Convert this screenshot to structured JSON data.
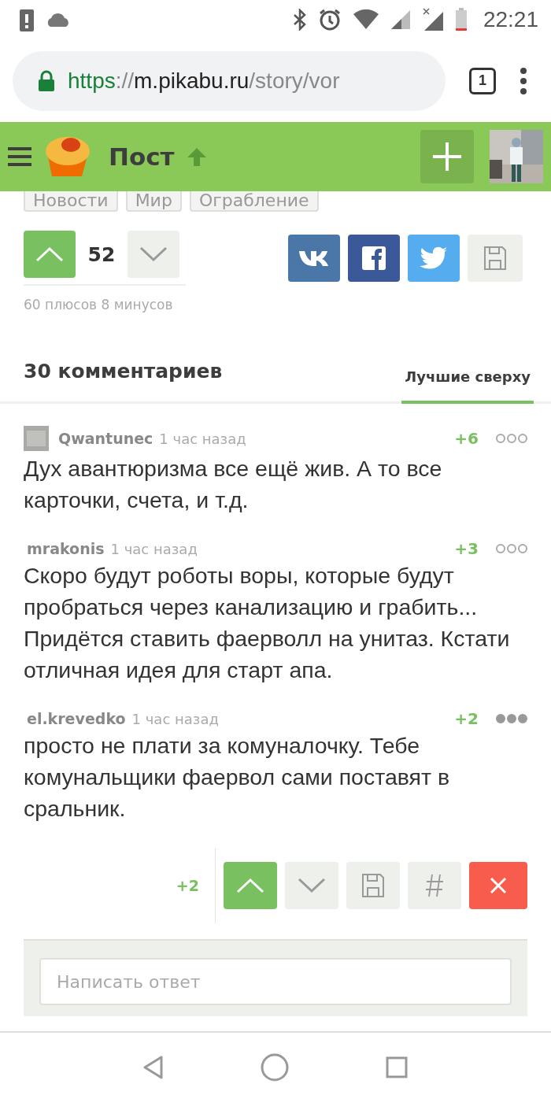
{
  "status_bar": {
    "time": "22:21"
  },
  "browser": {
    "url_scheme": "https",
    "url_separator": "://",
    "url_host": "m.pikabu.ru",
    "url_path": "/story/vor",
    "tab_count": "1"
  },
  "header": {
    "title": "Пост"
  },
  "tags": [
    "Новости",
    "Мир",
    "Ограбление"
  ],
  "post_rating": {
    "score": "52",
    "upvoted": true,
    "downvoted": false,
    "breakdown": "60 плюсов 8 минусов"
  },
  "comments_header": {
    "count_label": "30 комментариев",
    "sort_label": "Лучшие сверху"
  },
  "comments": [
    {
      "author": "Qwantunec",
      "time": "1 час назад",
      "rating": "+6",
      "text": "Дух авантюризма все ещё жив. А то все карточки, счета, и т.д.",
      "has_avatar": true,
      "menu_active": false
    },
    {
      "author": "mrakonis",
      "time": "1 час назад",
      "rating": "+3",
      "text": "Скоро будут роботы воры, которые будут пробраться через канализацию и грабить... Придётся ставить фаерволл на унитаз. Кстати отличная идея для старт апа.",
      "has_avatar": false,
      "menu_active": false
    },
    {
      "author": "el.krevedko",
      "time": "1 час назад",
      "rating": "+2",
      "text": "просто не плати за комуналочку. Тебе комунальщики фаервол сами поставят в сральник.",
      "has_avatar": false,
      "menu_active": true
    }
  ],
  "comment_actions": {
    "rating": "+2",
    "upvoted": true,
    "downvoted": false
  },
  "reply": {
    "placeholder": "Написать ответ"
  }
}
